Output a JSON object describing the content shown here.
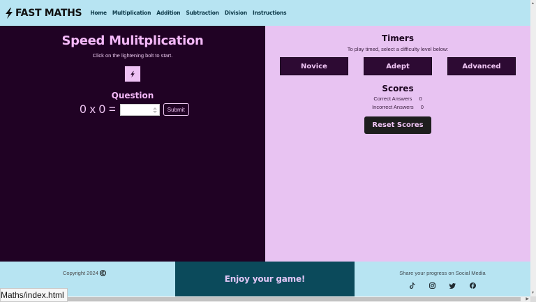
{
  "navbar": {
    "brand": "FAST MATHS",
    "links": [
      "Home",
      "Multiplication",
      "Addition",
      "Subtraction",
      "Division",
      "Instructions"
    ]
  },
  "game": {
    "title": "Speed Mulitplication",
    "hint": "Click on the lightening bolt to start.",
    "question_heading": "Question",
    "equation": "0 x 0 =",
    "answer_value": "",
    "submit_label": "Submit"
  },
  "timers": {
    "title": "Timers",
    "hint": "To play timed, select a difficulty level below:",
    "levels": [
      "Novice",
      "Adept",
      "Advanced"
    ]
  },
  "scores": {
    "title": "Scores",
    "correct_label": "Correct Answers",
    "correct_value": "0",
    "incorrect_label": "Incorrect Answers",
    "incorrect_value": "0",
    "reset_label": "Reset Scores"
  },
  "footer": {
    "copyright": "Copyright 2024",
    "tagline": "Enjoy your game!",
    "share": "Share your progress on Social Media",
    "socials": [
      "tiktok-icon",
      "instagram-icon",
      "twitter-icon",
      "facebook-icon"
    ]
  },
  "status_bar": {
    "url": "Maths/index.html"
  },
  "colors": {
    "nav_bg": "#b7e4f2",
    "left_bg": "#200224",
    "right_bg": "#e8c3f2",
    "footer_mid_bg": "#0b4a5b",
    "accent_pink": "#f3b8f7",
    "button_dark": "#2d0a33"
  }
}
